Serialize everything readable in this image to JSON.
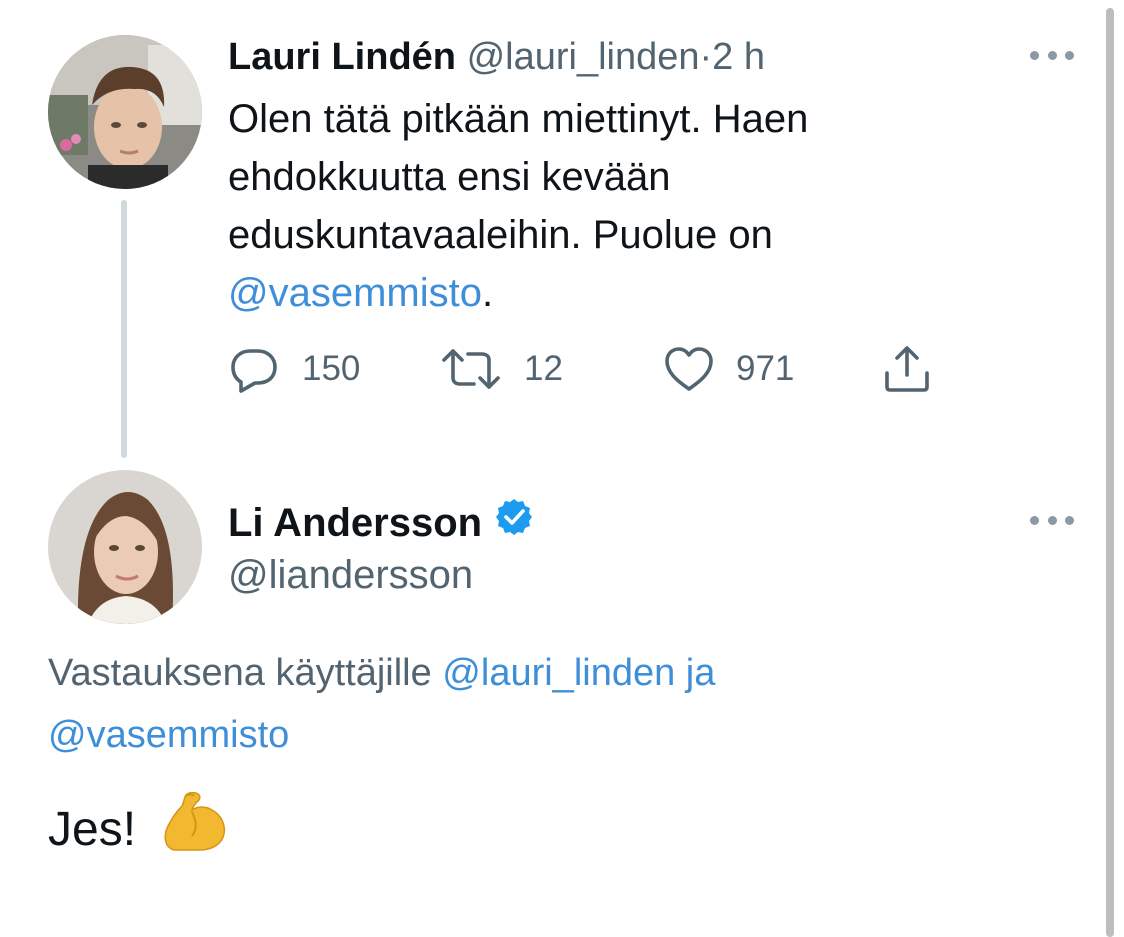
{
  "tweet1": {
    "author_name": "Lauri Lindén",
    "handle": "@lauri_linden",
    "separator": "·",
    "time": "2 h",
    "text_before_mention": "Olen tätä pitkään miettinyt. Haen ehdokkuutta ensi kevään eduskuntavaaleihin. Puolue on ",
    "mention": "@vasemmisto",
    "text_after_mention": ".",
    "actions": {
      "reply_count": "150",
      "retweet_count": "12",
      "like_count": "971"
    },
    "icons": {
      "reply": "reply-icon",
      "retweet": "retweet-icon",
      "like": "heart-icon",
      "share": "share-icon",
      "more": "more-options-icon"
    }
  },
  "tweet2": {
    "author_name": "Li Andersson",
    "verified": true,
    "handle": "@liandersson",
    "reply_prefix": "Vastauksena käyttäjille ",
    "reply_mention1": "@lauri_linden ja",
    "reply_mention2": "@vasemmisto",
    "text": "Jes!",
    "emoji": "flexed-biceps-emoji"
  },
  "colors": {
    "text": "#0f1419",
    "muted": "#536471",
    "link": "#3e8fd8",
    "verified": "#1d9bf0",
    "thread_line": "#cfd9de"
  }
}
